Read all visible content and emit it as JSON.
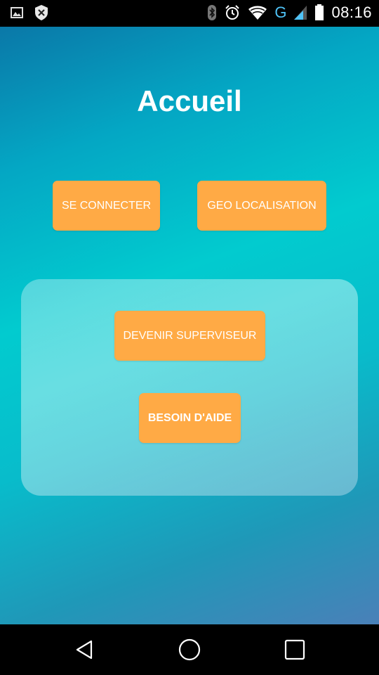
{
  "status_bar": {
    "time": "08:16",
    "network_type": "G",
    "icons": [
      "image-icon",
      "shield-x-icon",
      "bluetooth-icon",
      "alarm-icon",
      "wifi-icon",
      "signal-icon",
      "battery-icon"
    ]
  },
  "page": {
    "title": "Accueil"
  },
  "buttons": {
    "connect": "SE CONNECTER",
    "geolocation": "GEO LOCALISATION",
    "supervisor": "DEVENIR SUPERVISEUR",
    "help": "BESOIN D'AIDE"
  },
  "nav_bar": {
    "icons": [
      "back-icon",
      "home-icon",
      "recent-apps-icon"
    ]
  },
  "colors": {
    "button": "#ffaa45",
    "gradient_top": "#0a78a8",
    "gradient_mid": "#02cbcf",
    "gradient_bottom": "#4a80b8"
  }
}
